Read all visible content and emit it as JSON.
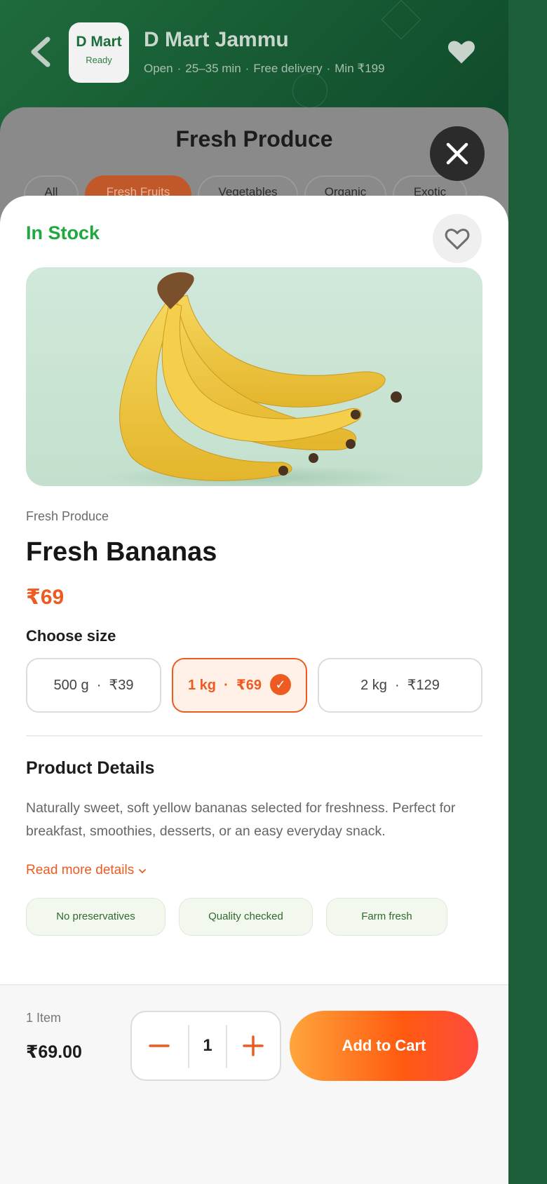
{
  "store": {
    "logo_line1": "D Mart",
    "logo_line2": "Ready",
    "name": "D Mart Jammu",
    "status": "Open",
    "eta": "25–35 min",
    "delivery": "Free delivery",
    "minimum": "Min ₹199"
  },
  "category": {
    "title": "Fresh Produce",
    "chips": [
      "All",
      "Fresh Fruits",
      "Vegetables",
      "Organic",
      "Exotic"
    ],
    "active_chip": "Fresh Fruits"
  },
  "product": {
    "stock_status": "In Stock",
    "breadcrumb": "Fresh Produce",
    "name": "Fresh Bananas",
    "price": "₹69",
    "size_title": "Choose size",
    "sizes": [
      {
        "weight": "500 g",
        "price": "₹39"
      },
      {
        "weight": "1 kg",
        "price": "₹69"
      },
      {
        "weight": "2 kg",
        "price": "₹129"
      }
    ],
    "selected_size": "1 kg",
    "details_title": "Product Details",
    "description": "Naturally sweet, soft yellow bananas selected for freshness. Perfect for breakfast, smoothies, desserts, or an easy everyday snack.",
    "read_more": "Read more details",
    "tags": [
      "No preservatives",
      "Quality checked",
      "Farm fresh"
    ]
  },
  "cart": {
    "item_count": "1 Item",
    "total": "₹69.00",
    "quantity": "1",
    "add_label": "Add to Cart"
  },
  "colors": {
    "brand_green": "#1f6b3d",
    "accent_orange": "#ee5a1f",
    "in_stock_green": "#1fa83f"
  }
}
